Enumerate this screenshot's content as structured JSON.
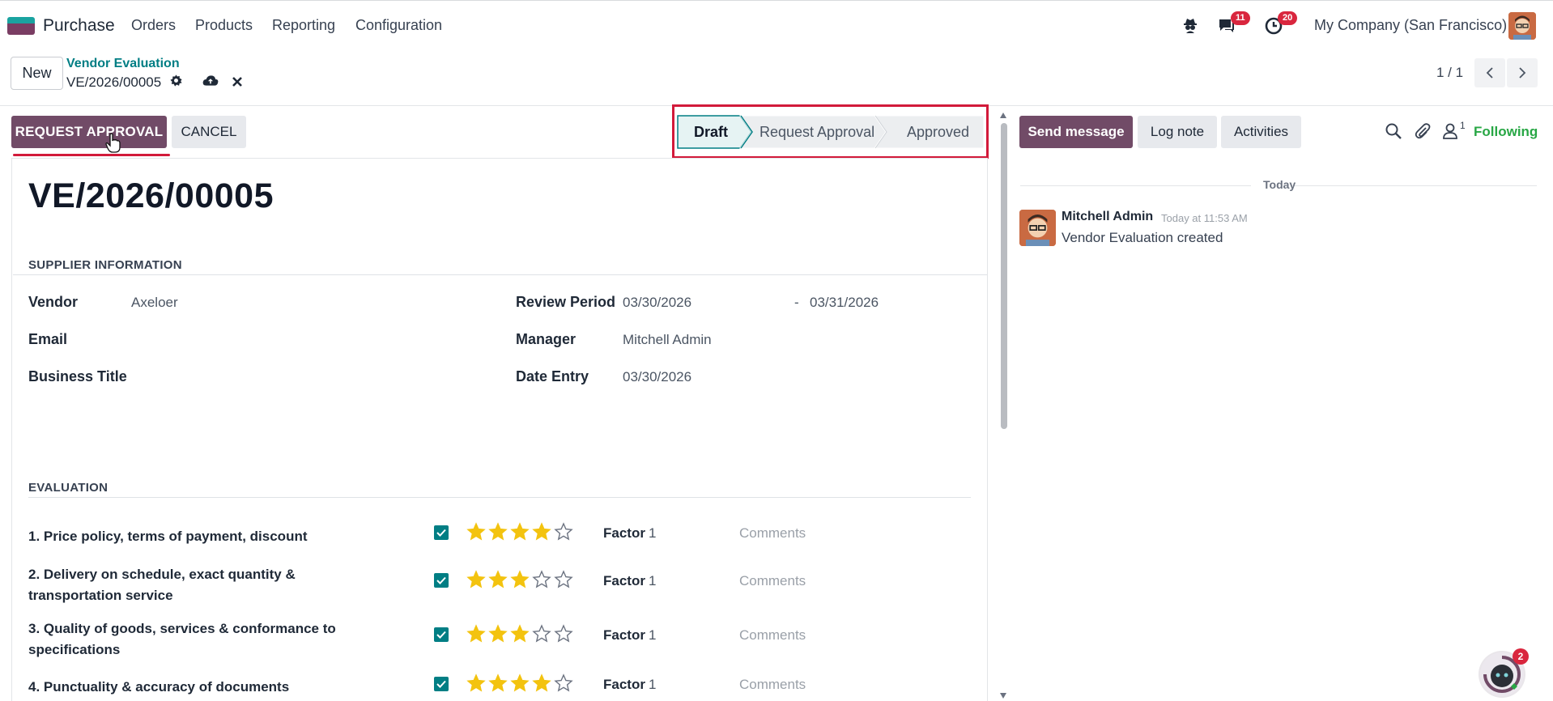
{
  "nav": {
    "app_name": "Purchase",
    "menu": [
      "Orders",
      "Products",
      "Reporting",
      "Configuration"
    ],
    "messages_badge": "11",
    "activities_badge": "20",
    "company": "My Company (San Francisco)"
  },
  "control_panel": {
    "new_label": "New",
    "breadcrumb_parent": "Vendor Evaluation",
    "breadcrumb_current": "VE/2026/00005",
    "pager": "1 / 1"
  },
  "form": {
    "request_approval_label": "REQUEST APPROVAL",
    "cancel_label": "CANCEL",
    "stages": [
      "Draft",
      "Request Approval",
      "Approved"
    ],
    "active_stage": "Draft",
    "title": "VE/2026/00005",
    "supplier_section": "SUPPLIER INFORMATION",
    "vendor_label": "Vendor",
    "vendor_value": "Axeloer",
    "email_label": "Email",
    "business_title_label": "Business Title",
    "review_period_label": "Review Period",
    "review_start": "03/30/2026",
    "review_sep": "-",
    "review_end": "03/31/2026",
    "manager_label": "Manager",
    "manager_value": "Mitchell Admin",
    "date_entry_label": "Date Entry",
    "date_entry_value": "03/30/2026",
    "evaluation_section": "EVALUATION",
    "criteria": [
      {
        "label": "1. Price policy, terms of payment, discount",
        "rating": 4,
        "factor_label": "Factor",
        "factor": "1",
        "comment": "Comments"
      },
      {
        "label": "2. Delivery on schedule, exact quantity & transportation service",
        "rating": 3,
        "factor_label": "Factor",
        "factor": "1",
        "comment": "Comments"
      },
      {
        "label": "3. Quality of goods, services & conformance to specifications",
        "rating": 3,
        "factor_label": "Factor",
        "factor": "1",
        "comment": "Comments"
      },
      {
        "label": "4. Punctuality & accuracy of documents",
        "rating": 4,
        "factor_label": "Factor",
        "factor": "1",
        "comment": "Comments"
      }
    ]
  },
  "chatter": {
    "send_message_label": "Send message",
    "log_note_label": "Log note",
    "activities_label": "Activities",
    "followers_count": "1",
    "following_label": "Following",
    "day_separator": "Today",
    "messages": [
      {
        "author": "Mitchell Admin",
        "time": "Today at 11:53 AM",
        "body": "Vendor Evaluation created"
      }
    ],
    "bot_badge": "2"
  },
  "colors": {
    "primary": "#714b67",
    "teal": "#017e84",
    "highlight_red": "#d21a3a",
    "following_green": "#28a745"
  }
}
